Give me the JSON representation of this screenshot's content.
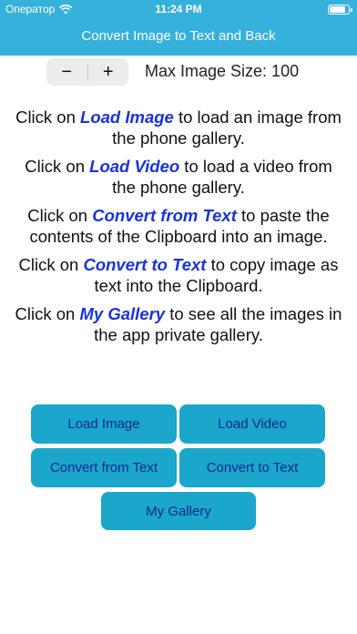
{
  "status_bar": {
    "carrier": "Оператор",
    "time": "11:24 PM",
    "wifi_icon": "wifi-icon",
    "battery_icon": "battery-icon"
  },
  "header": {
    "title": "Convert Image to Text and Back"
  },
  "stepper": {
    "minus": "−",
    "plus": "+"
  },
  "max_size_label": "Max Image Size: 100",
  "instructions": [
    {
      "pre": "Click on ",
      "action": "Load Image",
      "post": " to load an image from the phone gallery."
    },
    {
      "pre": "Click on ",
      "action": "Load Video",
      "post": " to load a video from the phone gallery."
    },
    {
      "pre": "Click on ",
      "action": "Convert from Text",
      "post": " to paste the contents of the Clipboard into an image."
    },
    {
      "pre": "Click on ",
      "action": "Convert to Text",
      "post": " to copy image as text into the Clipboard."
    },
    {
      "pre": "Click on ",
      "action": "My Gallery",
      "post": " to see all the images in the app private gallery."
    }
  ],
  "buttons": {
    "load_image": "Load Image",
    "load_video": "Load Video",
    "convert_from_text": "Convert from Text",
    "convert_to_text": "Convert to Text",
    "my_gallery": "My Gallery"
  },
  "colors": {
    "header": "#36b1dc",
    "button": "#1ba6cc",
    "button_text": "#0d2a8a",
    "emphasis": "#1a33d6"
  }
}
